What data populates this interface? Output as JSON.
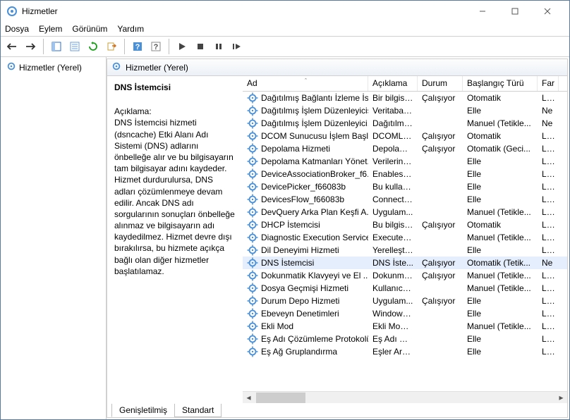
{
  "window": {
    "title": "Hizmetler"
  },
  "menubar": {
    "file": "Dosya",
    "action": "Eylem",
    "view": "Görünüm",
    "help": "Yardım"
  },
  "left": {
    "root": "Hizmetler (Yerel)"
  },
  "panehead": {
    "title": "Hizmetler (Yerel)"
  },
  "detail": {
    "title": "DNS İstemcisi",
    "desc_label": "Açıklama:",
    "desc": "DNS İstemcisi hizmeti (dsncache) Etki Alanı Adı Sistemi (DNS) adlarını önbelleğe alır ve bu bilgisayarın tam bilgisayar adını kaydeder. Hizmet durdurulursa, DNS adları çözümlenmeye devam edilir. Ancak DNS adı sorgularının sonuçları önbelleğe alınmaz ve bilgisayarın adı kaydedilmez. Hizmet devre dışı bırakılırsa, bu hizmete açıkça bağlı olan diğer hizmetler başlatılamaz."
  },
  "columns": {
    "name": "Ad",
    "desc": "Açıklama",
    "status": "Durum",
    "start": "Başlangıç Türü",
    "logon": "Far"
  },
  "tabs": {
    "extended": "Genişletilmiş",
    "standard": "Standart"
  },
  "services": [
    {
      "name": "Dağıtılmış Bağlantı İzleme İs...",
      "desc": "Bir bilgisa...",
      "status": "Çalışıyor",
      "start": "Otomatik",
      "logon": "Loc"
    },
    {
      "name": "Dağıtılmış İşlem Düzenleyicisi",
      "desc": "Veritaban...",
      "status": "",
      "start": "Elle",
      "logon": "Ne"
    },
    {
      "name": "Dağıtılmış İşlem Düzenleyici...",
      "desc": "Dağıtılmış...",
      "status": "",
      "start": "Manuel (Tetikle...",
      "logon": "Ne"
    },
    {
      "name": "DCOM Sunucusu İşlem Başl...",
      "desc": "DCOMLA...",
      "status": "Çalışıyor",
      "start": "Otomatik",
      "logon": "Loc"
    },
    {
      "name": "Depolama Hizmeti",
      "desc": "Depolam...",
      "status": "Çalışıyor",
      "start": "Otomatik (Geci...",
      "logon": "Loc"
    },
    {
      "name": "Depolama Katmanları Yönet...",
      "desc": "Verilerin, s...",
      "status": "",
      "start": "Elle",
      "logon": "Loc"
    },
    {
      "name": "DeviceAssociationBroker_f6...",
      "desc": "Enables a...",
      "status": "",
      "start": "Elle",
      "logon": "Loc"
    },
    {
      "name": "DevicePicker_f66083b",
      "desc": "Bu kullanı...",
      "status": "",
      "start": "Elle",
      "logon": "Loc"
    },
    {
      "name": "DevicesFlow_f66083b",
      "desc": "ConnectU...",
      "status": "",
      "start": "Elle",
      "logon": "Loc"
    },
    {
      "name": "DevQuery Arka Plan Keşfi A...",
      "desc": "Uygulam...",
      "status": "",
      "start": "Manuel (Tetikle...",
      "logon": "Loc"
    },
    {
      "name": "DHCP İstemcisi",
      "desc": "Bu bilgisa...",
      "status": "Çalışıyor",
      "start": "Otomatik",
      "logon": "Loc"
    },
    {
      "name": "Diagnostic Execution Service",
      "desc": "Executes ...",
      "status": "",
      "start": "Manuel (Tetikle...",
      "logon": "Loc"
    },
    {
      "name": "Dil Deneyimi Hizmeti",
      "desc": "Yerelleştiri...",
      "status": "",
      "start": "Elle",
      "logon": "Loc"
    },
    {
      "name": "DNS İstemcisi",
      "desc": "DNS İste...",
      "status": "Çalışıyor",
      "start": "Otomatik (Tetik...",
      "logon": "Ne",
      "selected": true
    },
    {
      "name": "Dokunmatik Klavyeyi ve El ...",
      "desc": "Dokunma...",
      "status": "Çalışıyor",
      "start": "Manuel (Tetikle...",
      "logon": "Loc"
    },
    {
      "name": "Dosya Geçmişi Hizmeti",
      "desc": "Kullanıcı ...",
      "status": "",
      "start": "Manuel (Tetikle...",
      "logon": "Loc"
    },
    {
      "name": "Durum Depo Hizmeti",
      "desc": "Uygulam...",
      "status": "Çalışıyor",
      "start": "Elle",
      "logon": "Loc"
    },
    {
      "name": "Ebeveyn Denetimleri",
      "desc": "Windows'...",
      "status": "",
      "start": "Elle",
      "logon": "Loc"
    },
    {
      "name": "Ekli Mod",
      "desc": "Ekli Mod ...",
      "status": "",
      "start": "Manuel (Tetikle...",
      "logon": "Loc"
    },
    {
      "name": "Eş Adı Çözümleme Protokolü",
      "desc": "Eş Adı Çö...",
      "status": "",
      "start": "Elle",
      "logon": "Loc"
    },
    {
      "name": "Eş Ağ Gruplandırma",
      "desc": "Eşler Arası...",
      "status": "",
      "start": "Elle",
      "logon": "Loc"
    }
  ]
}
